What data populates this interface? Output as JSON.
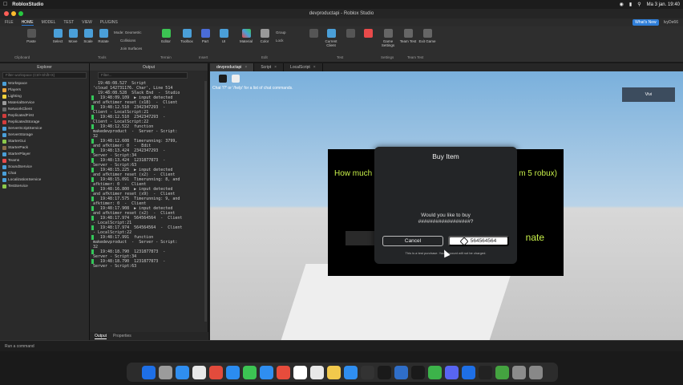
{
  "macbar": {
    "app": "RobloxStudio",
    "datetime": "Ma 3 jan. 19:40"
  },
  "window": {
    "title": "devproductapi - Roblox Studio"
  },
  "menu": {
    "file": "FILE",
    "tabs": [
      "HOME",
      "MODEL",
      "TEST",
      "VIEW",
      "PLUGINS"
    ],
    "active": "HOME",
    "whats_new": "What's New",
    "user": "IvyDe66"
  },
  "ribbon": {
    "buttons": [
      "Paste",
      "Select",
      "Move",
      "Scale",
      "Rotate",
      "Editor",
      "Toolbox",
      "Part",
      "UI",
      "Material",
      "Color",
      "Group",
      "Lock",
      "Current Client",
      "Game Settings",
      "Team Test",
      "Exit Game"
    ],
    "mode_label": "Mode:",
    "mode_value": "Geometric",
    "collisions": "Collisions",
    "join_surfaces": "Join Surfaces",
    "groups": [
      "Clipboard",
      "Tools",
      "Terrain",
      "Insert",
      "Edit",
      "Test",
      "Settings",
      "Team Test"
    ]
  },
  "explorer": {
    "title": "Explorer",
    "filter_placeholder": "Filter workspace (Ctrl+Shift+X)",
    "items": [
      {
        "label": "Workspace",
        "color": "#4a9fd8"
      },
      {
        "label": "Players",
        "color": "#e8a33c"
      },
      {
        "label": "Lighting",
        "color": "#f0d23c"
      },
      {
        "label": "MaterialService",
        "color": "#9b9b9b"
      },
      {
        "label": "NetworkClient",
        "color": "#6c6c6c"
      },
      {
        "label": "ReplicatedFirst",
        "color": "#d23c3c"
      },
      {
        "label": "ReplicatedStorage",
        "color": "#d23c3c"
      },
      {
        "label": "ServerScriptService",
        "color": "#4a9fd8"
      },
      {
        "label": "ServerStorage",
        "color": "#4a9fd8"
      },
      {
        "label": "StarterGui",
        "color": "#8cc84b"
      },
      {
        "label": "StarterPack",
        "color": "#8c6c4b"
      },
      {
        "label": "StarterPlayer",
        "color": "#4a9fd8"
      },
      {
        "label": "Teams",
        "color": "#e84a4a"
      },
      {
        "label": "SoundService",
        "color": "#4a9fd8"
      },
      {
        "label": "Chat",
        "color": "#4a9fd8"
      },
      {
        "label": "LocalizationService",
        "color": "#4a9fd8"
      },
      {
        "label": "TestService",
        "color": "#8cc84b"
      }
    ]
  },
  "output": {
    "title": "Output",
    "filter_placeholder": "Filter...",
    "lines": [
      {
        "text": "  19:48:08.527  Script",
        "mark": false
      },
      {
        "text": "'cloud_142731176._Char', Line 514",
        "mark": false
      },
      {
        "text": "  19:48:08.528  Stack End  -  Studio",
        "mark": false
      },
      {
        "text": "  19:48:09.109  ▶ input detected",
        "mark": true
      },
      {
        "text": "and afktimer reset (x18)  -  Client",
        "mark": false
      },
      {
        "text": "  19:48:12.510  2342347293  -",
        "mark": true
      },
      {
        "text": "Client - LocalScript:21",
        "mark": false
      },
      {
        "text": "  19:48:12.510  2342347293  -",
        "mark": true
      },
      {
        "text": "Client - LocalScript:22",
        "mark": false
      },
      {
        "text": "  19:48:12.522  function",
        "mark": true
      },
      {
        "text": "makedevproduct  -  Server - Script:",
        "mark": false
      },
      {
        "text": "32",
        "mark": false
      },
      {
        "text": "  19:48:12.608  Timerunning: 3799,",
        "mark": true
      },
      {
        "text": "and afktimer: 0  -  Edit",
        "mark": false
      },
      {
        "text": "  19:48:13.424  2342347293  -",
        "mark": true
      },
      {
        "text": "Server - Script:34",
        "mark": false
      },
      {
        "text": "  19:48:13.424  1231877873  -",
        "mark": true
      },
      {
        "text": "Server - Script:63",
        "mark": false
      },
      {
        "text": "  19:48:15.225  ▶ input detected",
        "mark": true
      },
      {
        "text": "and afktimer reset (x2)  -  Client",
        "mark": false
      },
      {
        "text": "  19:48:15.091  Timerunning: 8, and",
        "mark": true
      },
      {
        "text": "afktimer: 0  -  Client",
        "mark": false
      },
      {
        "text": "  19:48:16.800  ▶ input detected",
        "mark": true
      },
      {
        "text": "and afktimer reset (x9)  -  Client",
        "mark": false
      },
      {
        "text": "  19:48:17.575  Timerunning: 9, and",
        "mark": true
      },
      {
        "text": "afktimer: 0  -  Client",
        "mark": false
      },
      {
        "text": "  19:48:17.908  ▶ input detected",
        "mark": true
      },
      {
        "text": "and afktimer reset (x2)  -  Client",
        "mark": false
      },
      {
        "text": "  19:48:17.974  564564564  -  Client",
        "mark": true
      },
      {
        "text": "- LocalScript:21",
        "mark": false
      },
      {
        "text": "  19:48:17.974  564564564  -  Client",
        "mark": true
      },
      {
        "text": "- LocalScript:22",
        "mark": false
      },
      {
        "text": "  19:48:17.991  function",
        "mark": true
      },
      {
        "text": "makedevproduct  -  Server - Script:",
        "mark": false
      },
      {
        "text": "32",
        "mark": false
      },
      {
        "text": "  19:48:18.790  1231877873  -",
        "mark": true
      },
      {
        "text": "Server - Script:34",
        "mark": false
      },
      {
        "text": "  19:48:18.790  1231877873  -",
        "mark": true
      },
      {
        "text": "Server - Script:63",
        "mark": false
      }
    ]
  },
  "bottom_tabs": {
    "output": "Output",
    "properties": "Properties"
  },
  "command_bar": {
    "placeholder": "Run a command"
  },
  "viewport_tabs": [
    "devproductapi",
    "Script",
    "LocalScript"
  ],
  "viewport": {
    "chat_hint": "Chat '/?' or '/help' for a list of chat commands.",
    "player_tag": "Vivi",
    "game_text_left": "How much",
    "game_text_right": "m 5 robux)",
    "donate": "nate"
  },
  "purchase": {
    "title": "Buy Item",
    "question": "Would you like to buy",
    "item": "##################?",
    "cancel": "Cancel",
    "price": "564564564",
    "note": "This is a test purchase. Your account will not be charged."
  },
  "dock_colors": [
    "#1e6fe6",
    "#9b9b9b",
    "#2f8ef0",
    "#e8e8e8",
    "#e24b3c",
    "#2b8cf0",
    "#3cc453",
    "#2f8ef0",
    "#e74c3c",
    "#ffffff",
    "#e8e8e8",
    "#f2c94c",
    "#2f8ef0",
    "#333333",
    "#1a1a1a",
    "#2f6ec8",
    "#1a1a1a",
    "#3cb34a",
    "#5865f2",
    "#1e6fe6",
    "#222222",
    "#44a340",
    "#8c8c8c",
    "#888888"
  ]
}
